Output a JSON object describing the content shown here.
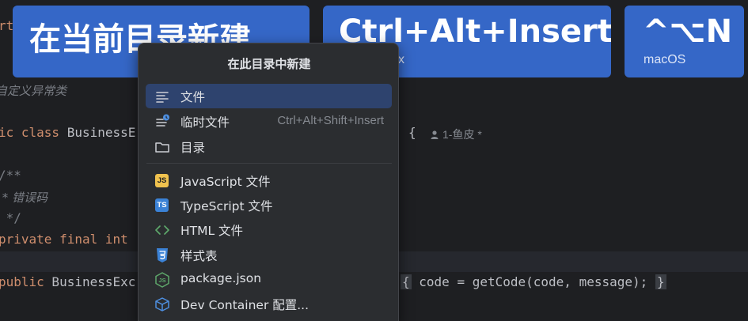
{
  "editor": {
    "line_import_fragment": "rt",
    "line_doc_comment": "自定义异常类",
    "line_class_decl_kw": "ic class",
    "line_class_decl_name": " BusinessE",
    "line_class_brace": "{",
    "author_hint": "1-鱼皮 *",
    "line_javadoc_open": "/**",
    "line_javadoc_body": " * 错误码",
    "line_javadoc_close": " */",
    "line_field_kw": "private final int",
    "line_ctor_kw": "public",
    "line_ctor_name": " BusinessExc",
    "line_ctor_body_open": "{",
    "line_ctor_body": " code = getCode(code, message); ",
    "line_ctor_body_close": "}"
  },
  "cards": [
    {
      "title": "在当前目录新建...",
      "subtitle": ""
    },
    {
      "title": "Ctrl+Alt+Insert",
      "subtitle": "x"
    },
    {
      "title": "^⌥N",
      "subtitle": "macOS"
    }
  ],
  "popup": {
    "title": "在此目录中新建",
    "items": [
      {
        "label": "文件",
        "shortcut": "",
        "icon": "file-lines-icon",
        "selected": true
      },
      {
        "label": "临时文件",
        "shortcut": "Ctrl+Alt+Shift+Insert",
        "icon": "scratch-file-icon"
      },
      {
        "label": "目录",
        "shortcut": "",
        "icon": "folder-icon"
      },
      {
        "label": "JavaScript 文件",
        "shortcut": "",
        "icon": "javascript-icon",
        "badge": "JS"
      },
      {
        "label": "TypeScript 文件",
        "shortcut": "",
        "icon": "typescript-icon",
        "badge": "TS"
      },
      {
        "label": "HTML 文件",
        "shortcut": "",
        "icon": "html-icon"
      },
      {
        "label": "样式表",
        "shortcut": "",
        "icon": "css-icon"
      },
      {
        "label": "package.json",
        "shortcut": "",
        "icon": "nodejs-icon"
      },
      {
        "label": "Dev Container 配置...",
        "shortcut": "",
        "icon": "cube-icon"
      }
    ]
  },
  "colors": {
    "editor_bg": "#1e1f22",
    "card_bg": "#3567c7",
    "popup_bg": "#2b2d30",
    "selected_bg": "#2e436e",
    "keyword": "#cf8e6d",
    "comment": "#7a7e85",
    "js_badge": "#f0c24e",
    "ts_badge": "#3b82d6",
    "html_icon": "#5ea86b",
    "css_icon": "#3b82d6",
    "node_icon": "#5ea86b",
    "cube_icon": "#4e8fe0"
  }
}
